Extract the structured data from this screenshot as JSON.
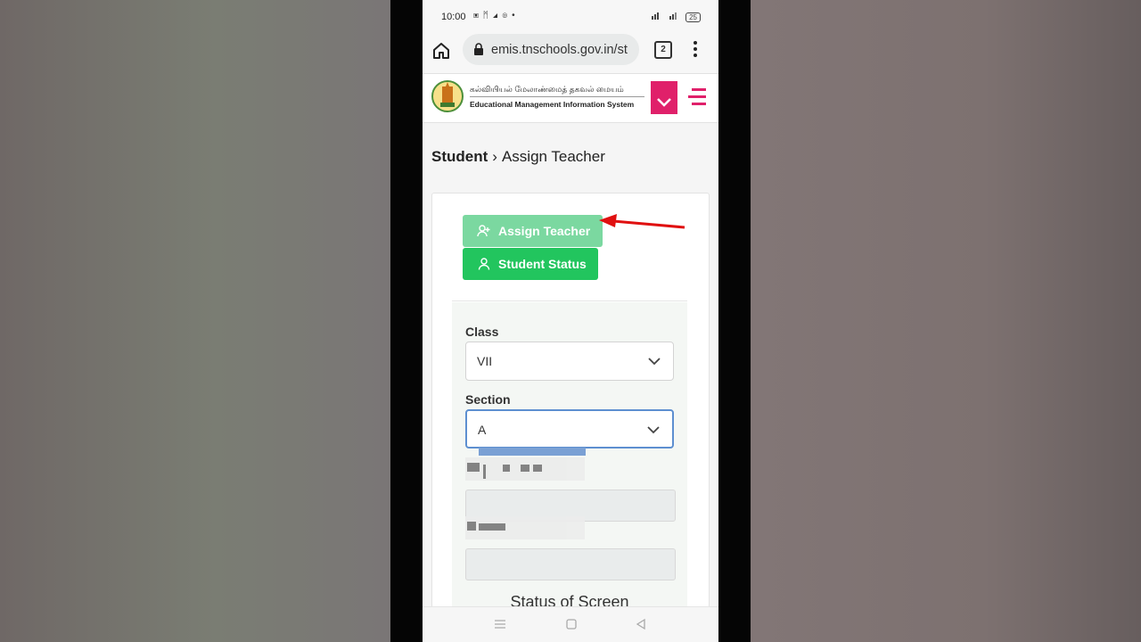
{
  "status_bar": {
    "time": "10:00",
    "app_icons": "▣ ᛗ ◢ ◎ •",
    "battery": "25"
  },
  "browser": {
    "url": "emis.tnschools.gov.in/st",
    "tab_count": "2"
  },
  "site": {
    "tamil_title": "கல்வியியல் மேலாண்மைத் தகவல் மையம்",
    "english_title": "Educational Management Information System",
    "accent_color": "#e0206a"
  },
  "breadcrumb": {
    "root": "Student",
    "separator": "›",
    "current": "Assign Teacher"
  },
  "actions": {
    "assign_teacher": "Assign Teacher",
    "student_status": "Student Status"
  },
  "form": {
    "class_label": "Class",
    "class_value": "VII",
    "section_label": "Section",
    "section_value": "A",
    "status_heading": "Status of Screen"
  },
  "colors": {
    "primary_green": "#22c55e",
    "light_green": "#7bd8a0",
    "annotation_arrow": "#e01010"
  }
}
